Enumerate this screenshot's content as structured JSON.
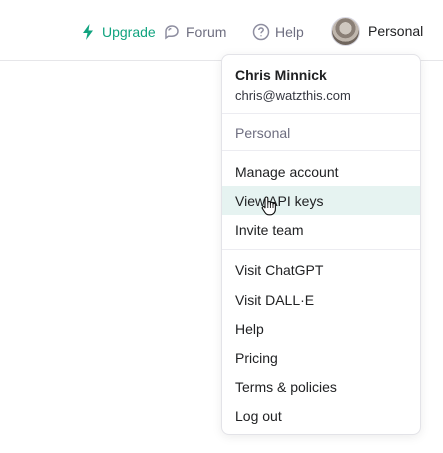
{
  "header": {
    "upgrade_label": "Upgrade",
    "forum_label": "Forum",
    "help_label": "Help",
    "personal_label": "Personal"
  },
  "menu": {
    "user_name": "Chris Minnick",
    "user_email": "chris@watzthis.com",
    "org_label": "Personal",
    "items": [
      {
        "label": "Manage account"
      },
      {
        "label": "View API keys",
        "hovered": true
      },
      {
        "label": "Invite team"
      },
      {
        "label": "Visit ChatGPT"
      },
      {
        "label": "Visit DALL·E"
      },
      {
        "label": "Help"
      },
      {
        "label": "Pricing"
      },
      {
        "label": "Terms & policies"
      },
      {
        "label": "Log out"
      }
    ]
  },
  "colors": {
    "accent": "#10a37f",
    "hover_bg": "#e6f3f1",
    "muted_text": "#6e6e80"
  },
  "icons": {
    "upgrade": "lightning-icon",
    "forum": "chat-bubbles-icon",
    "help": "question-circle-icon",
    "cursor": "hand-pointer-icon"
  }
}
